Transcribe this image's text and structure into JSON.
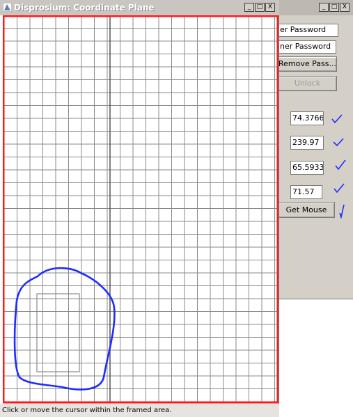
{
  "main_window": {
    "title": "Disprosium: Coordinate Plane",
    "status_text": "Click or move the cursor within the framed area.",
    "window_buttons": {
      "minimize": "_",
      "maximize": "□",
      "close": "X"
    }
  },
  "side_panel": {
    "window_buttons": {
      "minimize": "_",
      "maximize": "□",
      "close": "X"
    },
    "enter_password_field": "er Password",
    "owner_password_field": "ner Password",
    "remove_password_button": "Remove Pass...",
    "unlock_button": "Unlock",
    "values": [
      "74.37666",
      "239.97",
      "65.59332",
      "71.57"
    ],
    "get_mouse_button": "Get Mouse"
  },
  "colors": {
    "frame": "#ff1a1a",
    "grid": "#8a8a8a",
    "axis": "#555555",
    "annotation": "#1f2bff",
    "window_bg": "#d4d0c8"
  }
}
